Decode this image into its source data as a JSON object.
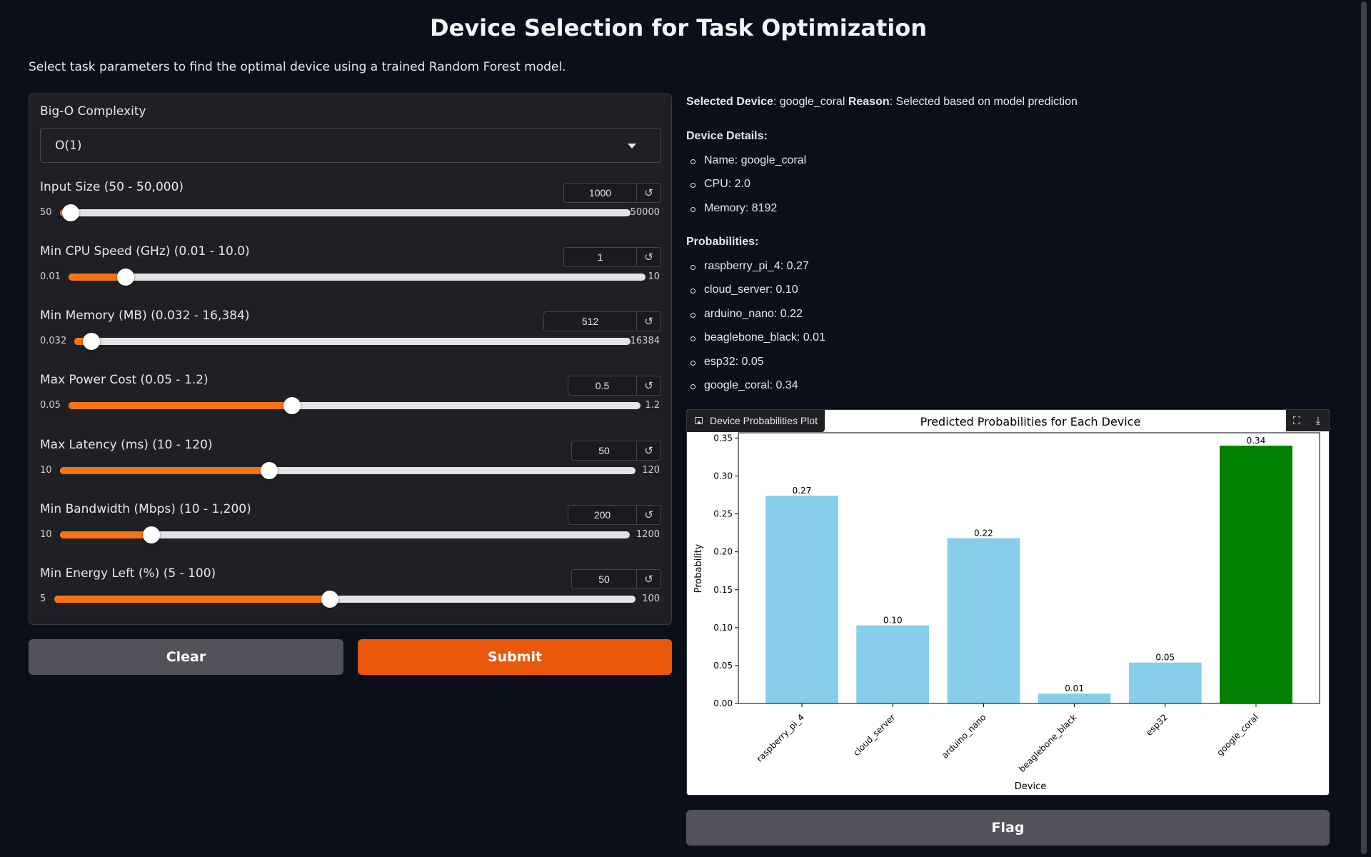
{
  "header": {
    "title": "Device Selection for Task Optimization",
    "description": "Select task parameters to find the optimal device using a trained Random Forest model."
  },
  "form": {
    "bigo": {
      "label": "Big-O Complexity",
      "value": "O(1)"
    },
    "sliders": [
      {
        "label": "Input Size (50 - 50,000)",
        "value": "1000",
        "min": "50",
        "max": "50000",
        "fraction": 0.019
      },
      {
        "label": "Min CPU Speed (GHz) (0.01 - 10.0)",
        "value": "1",
        "min": "0.01",
        "max": "10",
        "fraction": 0.099
      },
      {
        "label": "Min Memory (MB) (0.032 - 16,384)",
        "value": "512",
        "min": "0.032",
        "max": "16384",
        "fraction": 0.031
      },
      {
        "label": "Max Power Cost (0.05 - 1.2)",
        "value": "0.5",
        "min": "0.05",
        "max": "1.2",
        "fraction": 0.391
      },
      {
        "label": "Max Latency (ms) (10 - 120)",
        "value": "50",
        "min": "10",
        "max": "120",
        "fraction": 0.364
      },
      {
        "label": "Min Bandwidth (Mbps) (10 - 1,200)",
        "value": "200",
        "min": "10",
        "max": "1200",
        "fraction": 0.16
      },
      {
        "label": "Min Energy Left (%) (5 - 100)",
        "value": "50",
        "min": "5",
        "max": "100",
        "fraction": 0.474
      }
    ],
    "reset_glyph": "↺",
    "clear_label": "Clear",
    "submit_label": "Submit"
  },
  "result": {
    "selected_device_label": "Selected Device",
    "selected_device": "google_coral",
    "reason_label": "Reason",
    "reason": "Selected based on model prediction",
    "details_heading": "Device Details:",
    "details": [
      "Name: google_coral",
      "CPU: 2.0",
      "Memory: 8192"
    ],
    "probabilities_heading": "Probabilities:",
    "probabilities": [
      "raspberry_pi_4: 0.27",
      "cloud_server: 0.10",
      "arduino_nano: 0.22",
      "beaglebone_black: 0.01",
      "esp32: 0.05",
      "google_coral: 0.34"
    ]
  },
  "plot": {
    "tag_label": "Device Probabilities Plot",
    "fullscreen_glyph": "⛶",
    "download_glyph": "⤓"
  },
  "flag_label": "Flag",
  "icons": {
    "dropdown": "chevron-down-icon",
    "reset": "reset-icon",
    "plot": "image-icon",
    "fullscreen": "fullscreen-icon",
    "download": "download-icon"
  },
  "colors": {
    "accent": "#f97316",
    "submit": "#ea580c",
    "secondary_button": "#52525b",
    "bar_default": "#87ceeb",
    "bar_selected": "#008000"
  },
  "chart_data": {
    "type": "bar",
    "title": "Predicted Probabilities for Each Device",
    "xlabel": "Device",
    "ylabel": "Probability",
    "categories": [
      "raspberry_pi_4",
      "cloud_server",
      "arduino_nano",
      "beaglebone_black",
      "esp32",
      "google_coral"
    ],
    "values": [
      0.274,
      0.103,
      0.218,
      0.013,
      0.054,
      0.34
    ],
    "value_labels": [
      "0.27",
      "0.10",
      "0.22",
      "0.01",
      "0.05",
      "0.34"
    ],
    "highlight": "google_coral",
    "ylim": [
      0,
      0.357
    ],
    "yticks": [
      "0.00",
      "0.05",
      "0.10",
      "0.15",
      "0.20",
      "0.25",
      "0.30",
      "0.35"
    ],
    "grid": false,
    "legend": "none"
  }
}
